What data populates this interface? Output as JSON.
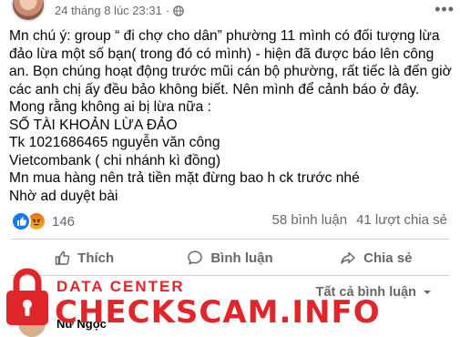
{
  "post": {
    "timestamp": "24 tháng 8 lúc 23:31",
    "separator": "·",
    "more_label": "•••",
    "lines": [
      "Mn chú ý: group “ đi chợ cho dân” phường 11 mình có đối tượng lừa",
      "đảo lừa một số bạn( trong đó có mình) - hiện đã được báo lên công",
      "an. Bọn chúng hoạt động trước mũi cán bộ phường, rất tiếc là đến giờ",
      "các anh chị ấy đều bảo không biết. Nên mình để cảnh báo ở đây.",
      "Mong rằng không ai bị lừa nữa :",
      "SỐ TÀI KHOẢN LỪA ĐẢO",
      "Tk 1021686465 nguyễn văn công",
      "Vietcombank ( chi nhánh kì đồng)",
      "Mn mua hàng nên trả tiền mặt đừng bao h ck trước nhé",
      "Nhờ ad duyệt bài"
    ]
  },
  "reactions": {
    "count": "146",
    "comments": "58 bình luận",
    "shares": "41 lượt chia sẻ"
  },
  "actions": {
    "like": "Thích",
    "comment": "Bình luận",
    "share": "Chia sẻ"
  },
  "comments": {
    "filter_label": "Tất cả bình luận",
    "first_commenter": "Nữ Ngọc"
  },
  "watermark": {
    "title": "DATA CENTER",
    "brand": "CHECKSCAM.INFO"
  },
  "colors": {
    "facebook_blue": "#1877f2",
    "watermark_red": "#e0262b",
    "secondary_text": "#65676b"
  }
}
